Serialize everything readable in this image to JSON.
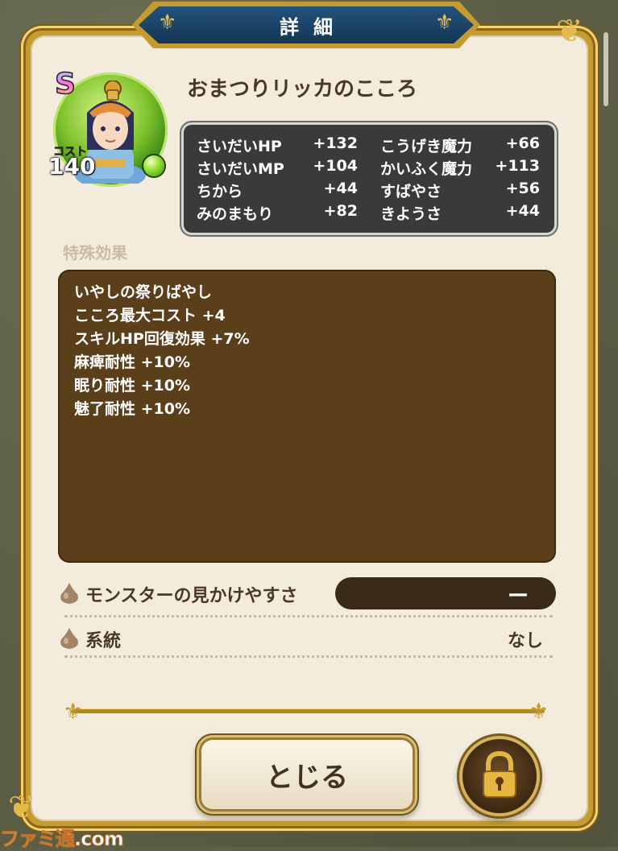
{
  "dialog": {
    "title": "詳細",
    "card_name": "おまつりリッカのこころ",
    "rank": "S",
    "cost_label": "コスト",
    "cost_value": "140"
  },
  "stats": [
    {
      "label": "さいだいHP",
      "value": "+132"
    },
    {
      "label": "こうげき魔力",
      "value": "+66"
    },
    {
      "label": "さいだいMP",
      "value": "+104"
    },
    {
      "label": "かいふく魔力",
      "value": "+113"
    },
    {
      "label": "ちから",
      "value": "+44"
    },
    {
      "label": "すばやさ",
      "value": "+56"
    },
    {
      "label": "みのまもり",
      "value": "+82"
    },
    {
      "label": "きようさ",
      "value": "+44"
    }
  ],
  "special_effects": {
    "label": "特殊効果",
    "items": [
      "いやしの祭りばやし",
      "こころ最大コスト +4",
      "スキルHP回復効果 +7%",
      "麻痺耐性 +10%",
      "眠り耐性 +10%",
      "魅了耐性 +10%"
    ]
  },
  "info": {
    "visibility_label": "モンスターの見かけやすさ",
    "visibility_value": "ー",
    "lineage_label": "系統",
    "lineage_value": "なし"
  },
  "buttons": {
    "close_label": "とじる"
  },
  "watermark": "ファミ通.com",
  "icons": {
    "lock": "lock-icon",
    "drop": "drop-icon",
    "orb": "green-orb-icon"
  },
  "colors": {
    "panel": "#f3ebdb",
    "frame_gold": "#c59a2e",
    "title_blue": "#1e4a70",
    "effects_brown": "#5b3e1a",
    "stat_dark": "#3a3a3a"
  }
}
